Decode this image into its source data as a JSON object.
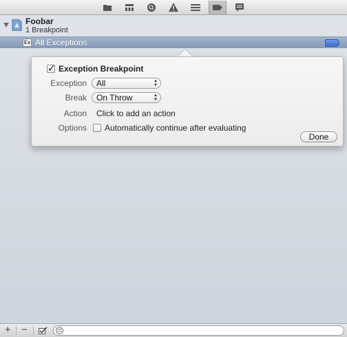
{
  "navigator": {
    "tabs": [
      {
        "icon": "folder-icon"
      },
      {
        "icon": "hierarchy-icon"
      },
      {
        "icon": "search-icon"
      },
      {
        "icon": "warning-icon"
      },
      {
        "icon": "list-icon"
      },
      {
        "icon": "breakpoint-icon",
        "selected": true
      },
      {
        "icon": "log-icon"
      }
    ]
  },
  "project": {
    "name": "Foobar",
    "subtitle": "1 Breakpoint"
  },
  "breakpoint": {
    "badge": "Ex",
    "label": "All Exceptions",
    "tag_color": "#4a7fd6"
  },
  "popover": {
    "enabled": true,
    "title": "Exception Breakpoint",
    "exception_label": "Exception",
    "exception_value": "All",
    "break_label": "Break",
    "break_value": "On Throw",
    "action_label": "Action",
    "action_text": "Click to add an action",
    "options_label": "Options",
    "options_text": "Automatically continue after evaluating",
    "options_checked": false,
    "done_label": "Done"
  },
  "bottombar": {
    "add_label": "+",
    "remove_label": "−",
    "filter_value": "",
    "filter_placeholder": ""
  },
  "colors": {
    "selection": "#8fa2bd",
    "background": "#d8dce3"
  }
}
